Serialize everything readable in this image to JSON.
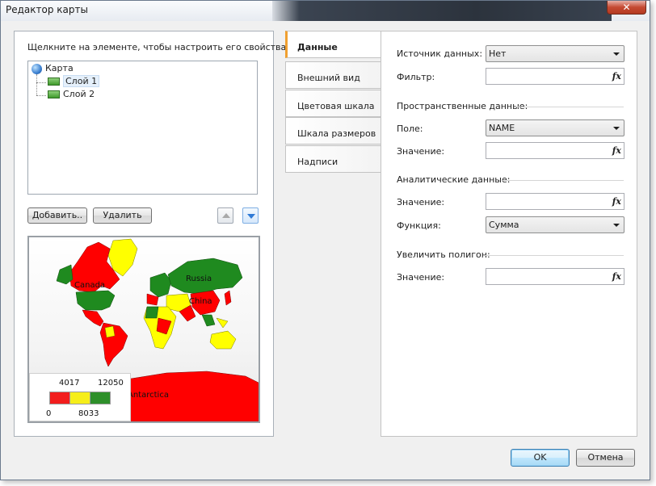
{
  "window": {
    "title": "Редактор карты",
    "close_glyph": "✕"
  },
  "left": {
    "hint": "Щелкните на элементе, чтобы настроить его свойства:",
    "tree": {
      "root": {
        "label": "Карта",
        "icon": "globe-icon"
      },
      "children": [
        {
          "label": "Слой 1",
          "icon": "layer-icon",
          "selected": true
        },
        {
          "label": "Слой 2",
          "icon": "layer-icon",
          "selected": false
        }
      ]
    },
    "buttons": {
      "add": "Добавить..",
      "delete": "Удалить",
      "move_up_icon": "arrow-up-icon",
      "move_down_icon": "arrow-down-icon"
    },
    "map_preview": {
      "labels": {
        "canada": "Canada",
        "russia": "Russia",
        "china": "China",
        "antarctica": "Antarctica"
      },
      "legend": {
        "top_left": "4017",
        "top_right": "12050",
        "bottom_left": "0",
        "bottom_mid": "8033",
        "colors": [
          "#f21d1d",
          "#f6ee1a",
          "#2e8f2a"
        ]
      },
      "colors": {
        "red": "#ff0000",
        "yellow": "#ffff00",
        "green": "#1f8a1f"
      }
    }
  },
  "tabs": [
    {
      "label": "Данные",
      "active": true
    },
    {
      "label": "Внешний вид",
      "active": false
    },
    {
      "label": "Цветовая шкала",
      "active": false
    },
    {
      "label": "Шкала размеров",
      "active": false
    },
    {
      "label": "Надписи",
      "active": false
    }
  ],
  "data_tab": {
    "source_label": "Источник данных:",
    "source_value": "Нет",
    "filter_label": "Фильтр:",
    "filter_value": "",
    "spatial_section": "Пространственные данные:",
    "field_label": "Поле:",
    "field_value": "NAME",
    "spatial_value_label": "Значение:",
    "spatial_value": "",
    "analytic_section": "Аналитические данные:",
    "analytic_value_label": "Значение:",
    "analytic_value": "",
    "function_label": "Функция:",
    "function_value": "Сумма",
    "polygon_section": "Увеличить полигон:",
    "polygon_value_label": "Значение:",
    "polygon_value": "",
    "fx_glyph": "fx"
  },
  "footer": {
    "ok": "OK",
    "cancel": "Отмена"
  },
  "accent": "#f0a030"
}
